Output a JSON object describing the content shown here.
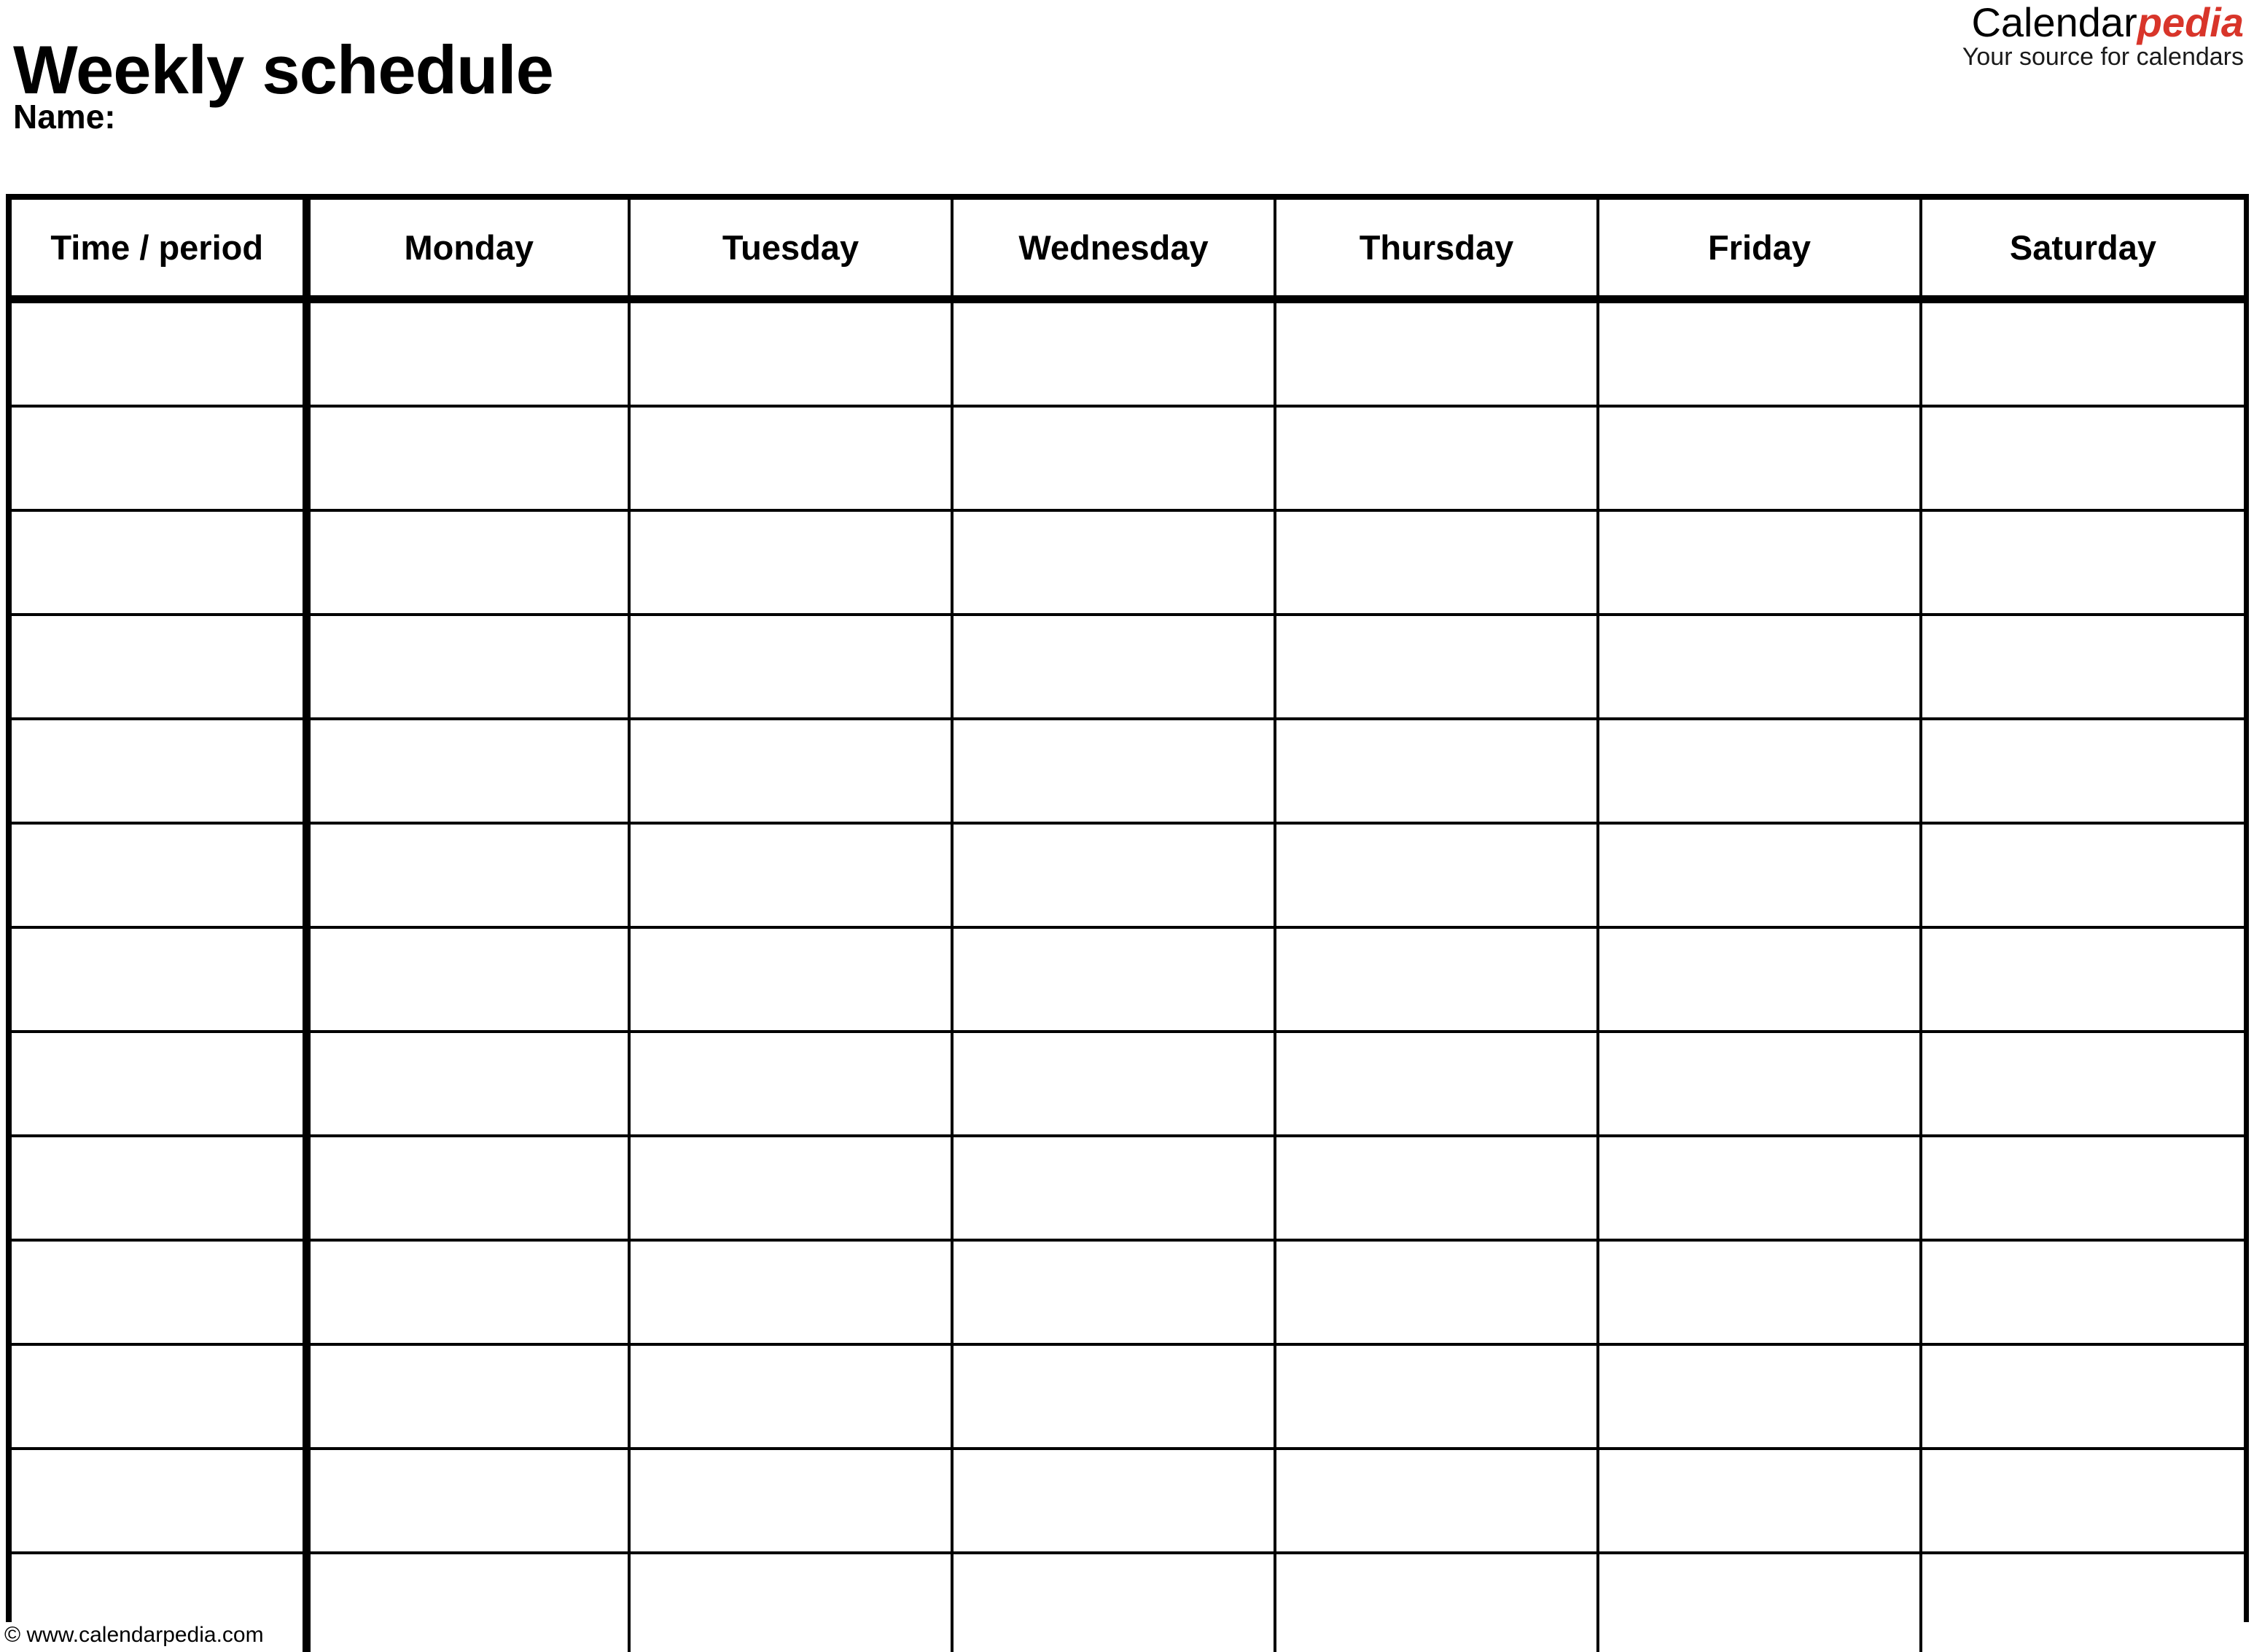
{
  "document": {
    "title": "Weekly schedule",
    "name_label": "Name:"
  },
  "logo": {
    "brand_primary": "Calendar",
    "brand_accent": "pedia",
    "tagline": "Your source for calendars",
    "accent_color": "#D8352A"
  },
  "table": {
    "columns": [
      "Time / period",
      "Monday",
      "Tuesday",
      "Wednesday",
      "Thursday",
      "Friday",
      "Saturday"
    ],
    "row_count": 13,
    "rows": [
      [
        "",
        "",
        "",
        "",
        "",
        "",
        ""
      ],
      [
        "",
        "",
        "",
        "",
        "",
        "",
        ""
      ],
      [
        "",
        "",
        "",
        "",
        "",
        "",
        ""
      ],
      [
        "",
        "",
        "",
        "",
        "",
        "",
        ""
      ],
      [
        "",
        "",
        "",
        "",
        "",
        "",
        ""
      ],
      [
        "",
        "",
        "",
        "",
        "",
        "",
        ""
      ],
      [
        "",
        "",
        "",
        "",
        "",
        "",
        ""
      ],
      [
        "",
        "",
        "",
        "",
        "",
        "",
        ""
      ],
      [
        "",
        "",
        "",
        "",
        "",
        "",
        ""
      ],
      [
        "",
        "",
        "",
        "",
        "",
        "",
        ""
      ],
      [
        "",
        "",
        "",
        "",
        "",
        "",
        ""
      ],
      [
        "",
        "",
        "",
        "",
        "",
        "",
        ""
      ],
      [
        "",
        "",
        "",
        "",
        "",
        "",
        ""
      ]
    ]
  },
  "footer": {
    "credit": "© www.calendarpedia.com"
  }
}
